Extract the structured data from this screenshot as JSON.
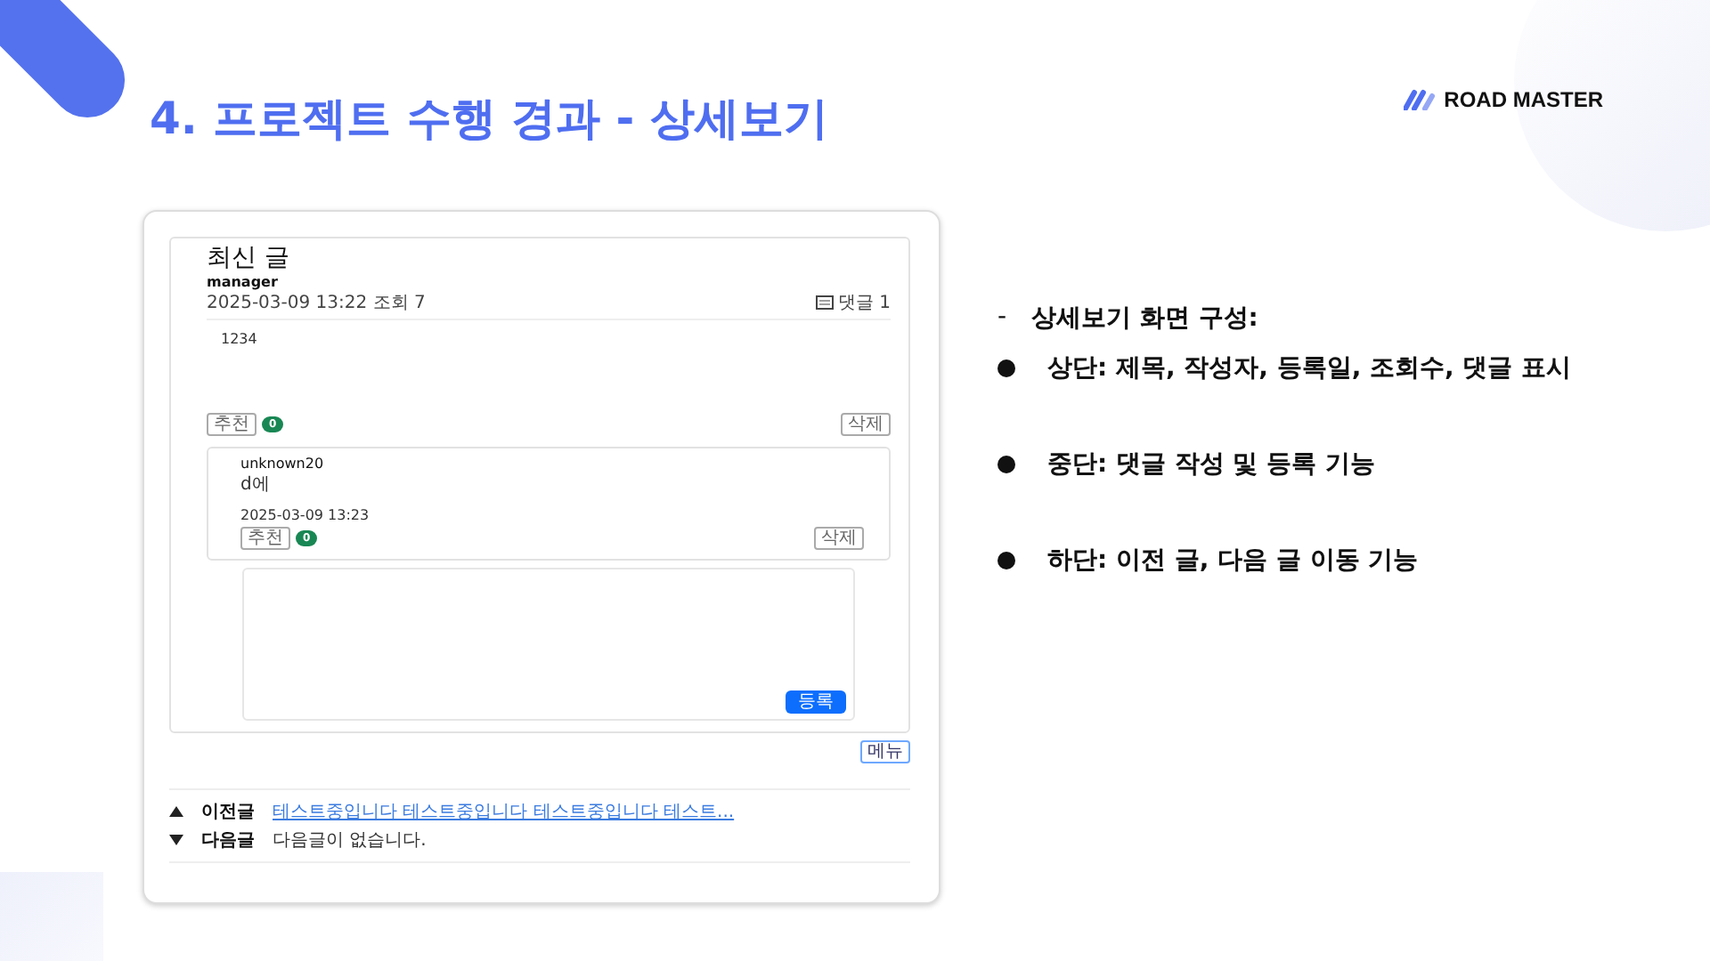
{
  "slide": {
    "title": "4. 프로젝트 수행 경과 - 상세보기",
    "logo": "ROAD MASTER"
  },
  "post": {
    "heading": "최신 글",
    "author": "manager",
    "meta": "2025-03-09 13:22  조회 7",
    "comment_count": "댓글 1",
    "body": "1234",
    "recommend": "추천",
    "likes": "0",
    "delete": "삭제"
  },
  "comments": [
    {
      "author": "unknown20",
      "text": "d에",
      "date": "2025-03-09 13:23",
      "recommend": "추천",
      "likes": "0",
      "delete": "삭제"
    }
  ],
  "comment_form": {
    "submit": "등록"
  },
  "menu_button": "메뉴",
  "nav": [
    {
      "kind": "prev",
      "label": "이전글",
      "text": "테스트중입니다 테스트중입니다 테스트중입니다 테스트...",
      "link": true
    },
    {
      "kind": "next",
      "label": "다음글",
      "text": "다음글이 없습니다.",
      "link": false
    }
  ],
  "notes": {
    "marker": "-",
    "heading": "상세보기 화면 구성:",
    "items": [
      "상단: 제목, 작성자, 등록일, 조회수, 댓글 표시",
      "중단: 댓글 작성 및 등록 기능",
      "하단: 이전 글, 다음 글 이동 기능"
    ]
  }
}
